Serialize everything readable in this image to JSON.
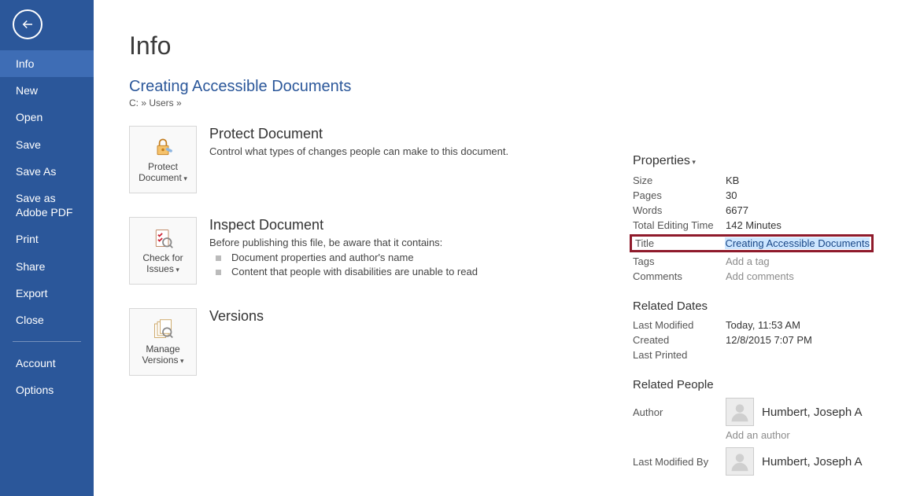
{
  "sidebar": {
    "items": [
      {
        "label": "Info",
        "active": true
      },
      {
        "label": "New"
      },
      {
        "label": "Open"
      },
      {
        "label": "Save"
      },
      {
        "label": "Save As"
      },
      {
        "label": "Save as Adobe PDF"
      },
      {
        "label": "Print"
      },
      {
        "label": "Share"
      },
      {
        "label": "Export"
      },
      {
        "label": "Close"
      }
    ],
    "footer": [
      {
        "label": "Account"
      },
      {
        "label": "Options"
      }
    ]
  },
  "page": {
    "title": "Info",
    "doc_title": "Creating Accessible Documents",
    "doc_path": "C: » Users »"
  },
  "sections": {
    "protect": {
      "tile": "Protect Document",
      "heading": "Protect Document",
      "text": "Control what types of changes people can make to this document."
    },
    "inspect": {
      "tile": "Check for Issues",
      "heading": "Inspect Document",
      "text": "Before publishing this file, be aware that it contains:",
      "bullets": [
        "Document properties and author's name",
        "Content that people with disabilities are unable to read"
      ]
    },
    "versions": {
      "tile": "Manage Versions",
      "heading": "Versions"
    }
  },
  "properties": {
    "heading": "Properties",
    "rows": {
      "size_label": "Size",
      "size_value": "KB",
      "pages_label": "Pages",
      "pages_value": "30",
      "words_label": "Words",
      "words_value": "6677",
      "editing_label": "Total Editing Time",
      "editing_value": "142 Minutes",
      "title_label": "Title",
      "title_value": "Creating Accessible Documents",
      "tags_label": "Tags",
      "tags_value": "Add a tag",
      "comments_label": "Comments",
      "comments_value": "Add comments"
    },
    "dates": {
      "heading": "Related Dates",
      "modified_label": "Last Modified",
      "modified_value": "Today, 11:53 AM",
      "created_label": "Created",
      "created_value": "12/8/2015 7:07 PM",
      "printed_label": "Last Printed",
      "printed_value": ""
    },
    "people": {
      "heading": "Related People",
      "author_label": "Author",
      "author_name": "Humbert, Joseph A",
      "add_author": "Add an author",
      "modified_by_label": "Last Modified By",
      "modified_by_name": "Humbert, Joseph A"
    }
  }
}
